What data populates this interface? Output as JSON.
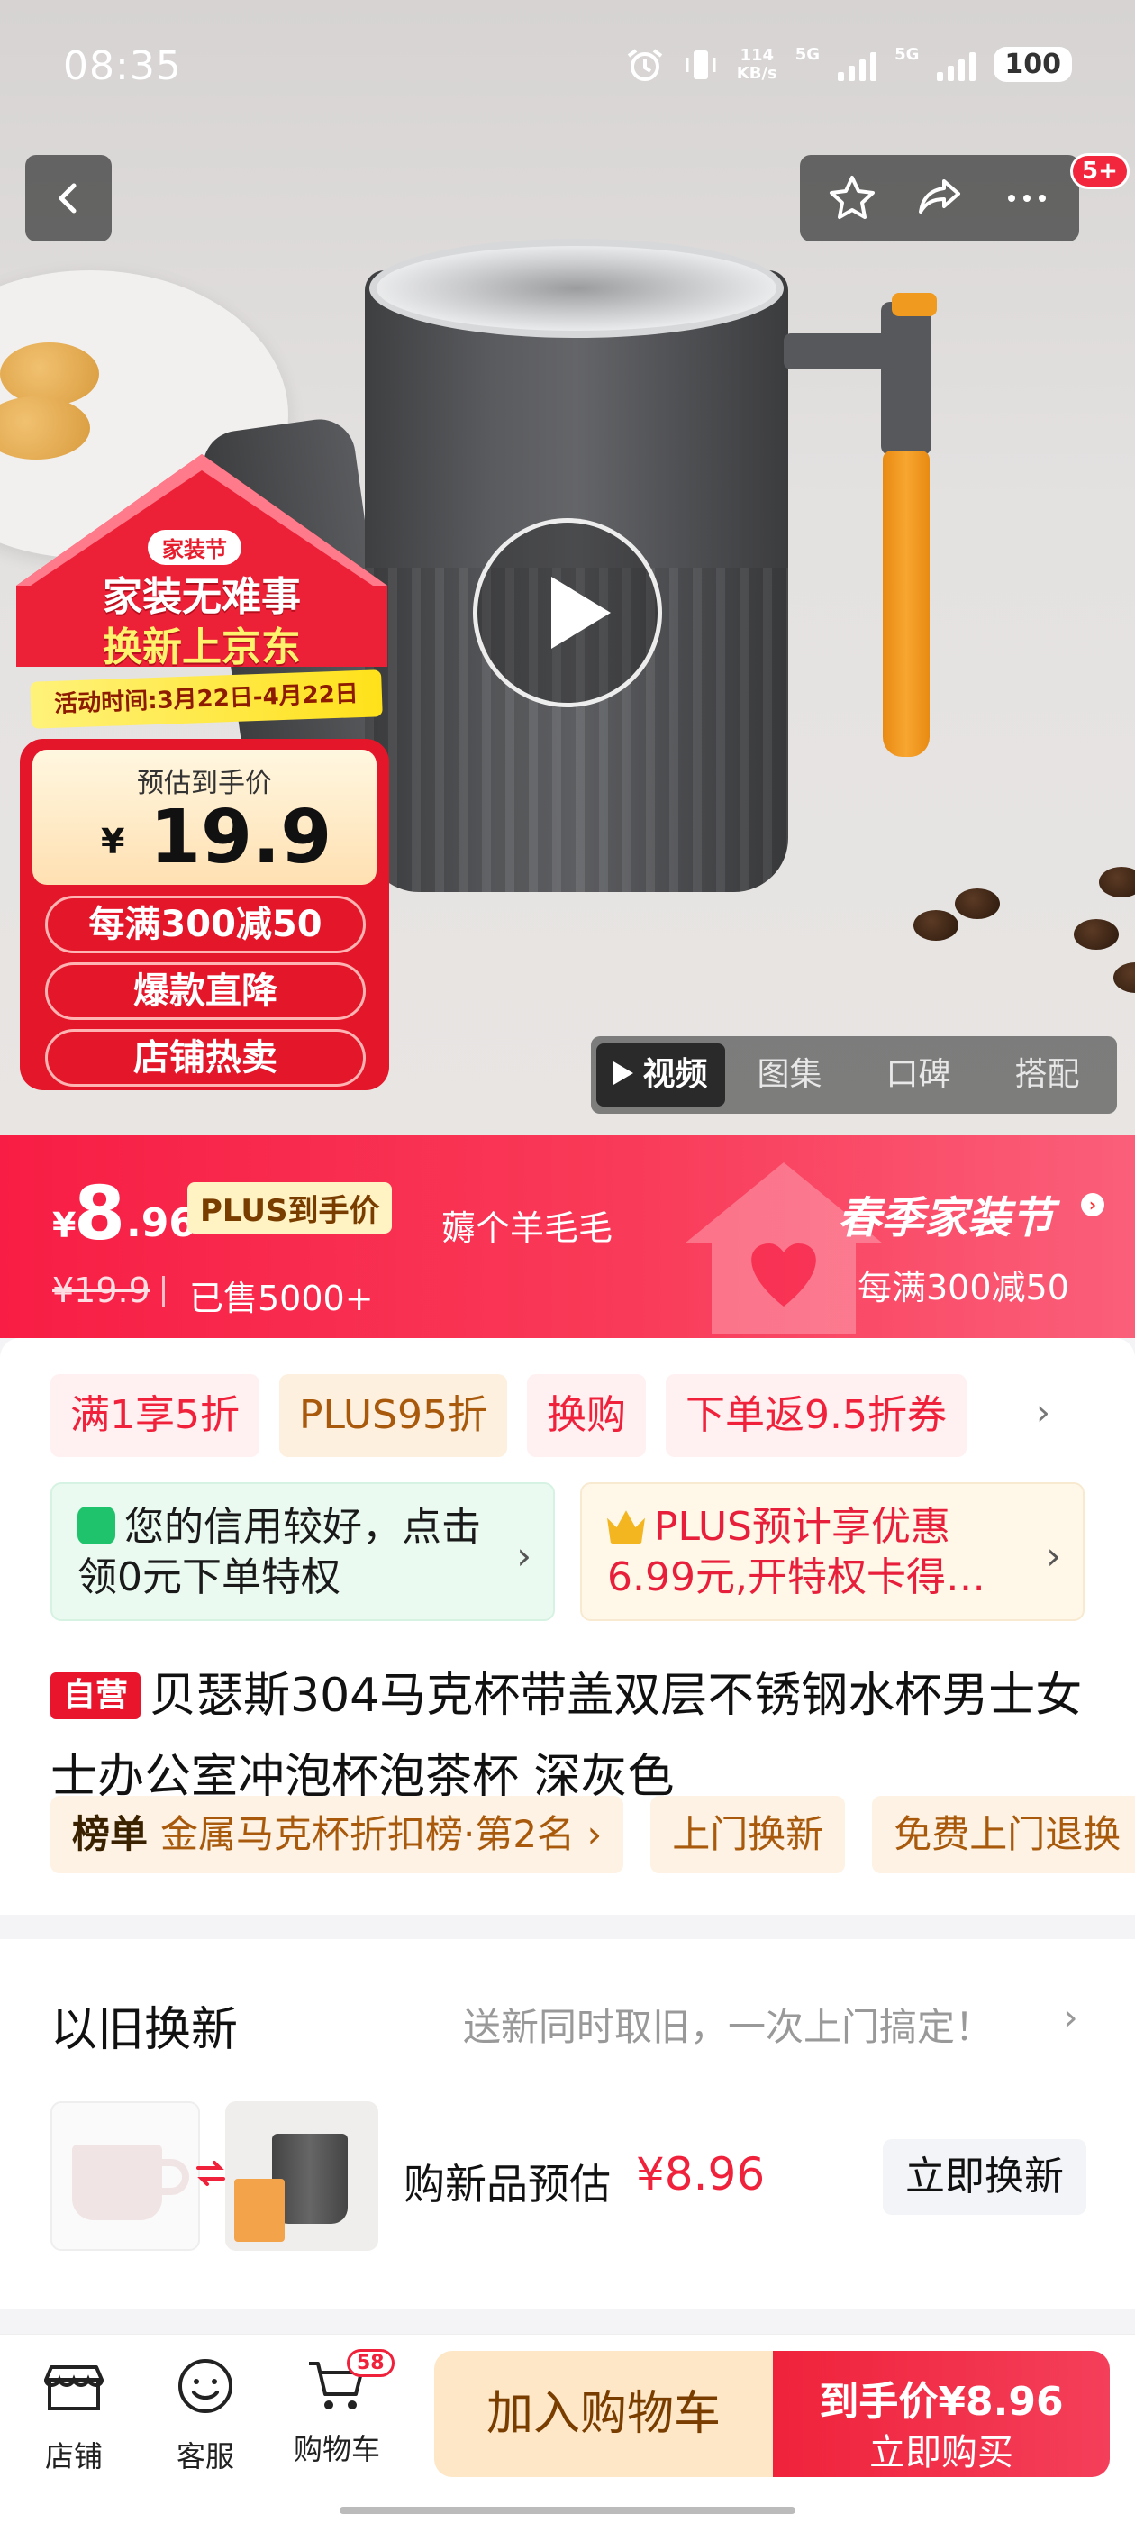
{
  "status_bar": {
    "time": "08:35",
    "net_speed_value": "114",
    "net_speed_unit": "KB/s",
    "network1": "5G",
    "network2": "5G",
    "battery": "100"
  },
  "nav": {
    "msg_badge": "5+"
  },
  "promo": {
    "brand": "家装节",
    "line1": "家装无难事",
    "line2": "换新上京东",
    "date": "活动时间:3月22日-4月22日",
    "price_label": "预估到手价",
    "currency": "¥",
    "price": "19.9",
    "tags": [
      "每满300减50",
      "爆款直降",
      "店铺热卖"
    ]
  },
  "media_tabs": [
    {
      "label": "视频",
      "active": true
    },
    {
      "label": "图集",
      "active": false
    },
    {
      "label": "口碑",
      "active": false
    },
    {
      "label": "搭配",
      "active": false
    }
  ],
  "price_banner": {
    "currency": "¥",
    "price_int": "8",
    "price_dec": ".96",
    "plus_label": "PLUS到手价",
    "original_price": "¥19.9",
    "sold": "已售5000+",
    "wool": "薅个羊毛毛",
    "event_title": "春季家装节",
    "event_sub": "每满300减50"
  },
  "coupons": [
    {
      "label": "满1享5折",
      "kind": "red"
    },
    {
      "label": "PLUS95折",
      "kind": "plus"
    },
    {
      "label": "换购",
      "kind": "red"
    },
    {
      "label": "下单返9.5折券",
      "kind": "red"
    }
  ],
  "benefits": {
    "credit_text": "您的信用较好，点击领0元下单特权",
    "plus_text_1": "PLUS预计享优惠",
    "plus_text_2": "6.99元,开特权卡得…"
  },
  "product": {
    "self_tag": "自营",
    "title": "贝瑟斯304马克杯带盖双层不锈钢水杯男士女士办公室冲泡杯泡茶杯 深灰色"
  },
  "ranking": {
    "rank_label": "榜单",
    "rank_text": "金属马克杯折扣榜·第2名 ›",
    "chips": [
      "上门换新",
      "免费上门退换"
    ]
  },
  "trade_in": {
    "title": "以旧换新",
    "desc": "送新同时取旧，一次上门搞定！",
    "chevron": "›",
    "estimate_label": "购新品预估",
    "estimate_price": "¥8.96",
    "button": "立即换新"
  },
  "bottom_bar": {
    "shop": "店铺",
    "service": "客服",
    "cart": "购物车",
    "cart_count": "58",
    "add_cart": "加入购物车",
    "buy_line1": "到手价¥8.96",
    "buy_line2": "立即购买"
  }
}
